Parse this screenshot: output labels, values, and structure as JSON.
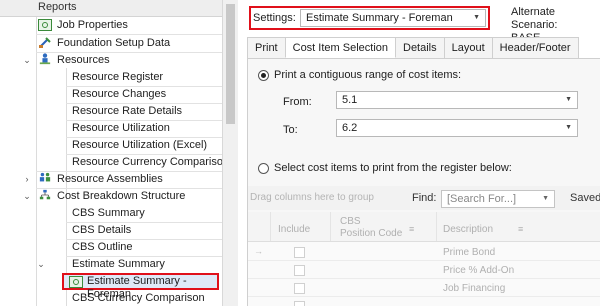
{
  "tree": {
    "header": "Reports",
    "items": [
      {
        "label": "Job Properties"
      },
      {
        "label": "Foundation Setup Data"
      },
      {
        "label": "Resources"
      },
      {
        "label": "Resource Register"
      },
      {
        "label": "Resource Changes"
      },
      {
        "label": "Resource Rate Details"
      },
      {
        "label": "Resource Utilization"
      },
      {
        "label": "Resource Utilization (Excel)"
      },
      {
        "label": "Resource Currency Comparison"
      },
      {
        "label": "Resource Assemblies"
      },
      {
        "label": "Cost Breakdown Structure"
      },
      {
        "label": "CBS Summary"
      },
      {
        "label": "CBS Details"
      },
      {
        "label": "CBS Outline"
      },
      {
        "label": "Estimate Summary"
      },
      {
        "label": "Estimate Summary - Foreman"
      },
      {
        "label": "CBS Currency Comparison"
      }
    ]
  },
  "settings": {
    "label": "Settings:",
    "value": "Estimate Summary - Foreman",
    "alt_label": "Alternate Scenario:",
    "alt_value": "BASE"
  },
  "tabs": [
    "Print",
    "Cost Item Selection",
    "Details",
    "Layout",
    "Header/Footer"
  ],
  "selection": {
    "option1": "Print a contiguous range of cost items:",
    "from_label": "From:",
    "from_value": "5.1",
    "to_label": "To:",
    "to_value": "6.2",
    "option2": "Select cost items to print from the register below:"
  },
  "grid": {
    "drag_hint": "Drag columns here to group",
    "find_label": "Find:",
    "find_placeholder": "[Search For...]",
    "saved_label": "Saved",
    "columns": [
      "Include",
      "CBS",
      "Position Code",
      "Description"
    ],
    "rows": [
      "Prime Bond",
      "Price % Add-On",
      "Job Financing",
      ""
    ]
  },
  "colors": {
    "highlight": "#e0101a",
    "selection_bg": "#dfe9f7"
  }
}
